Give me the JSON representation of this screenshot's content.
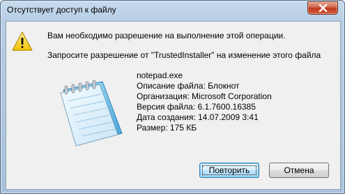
{
  "window": {
    "title": "Отсутствует доступ к файлу",
    "close_glyph": "close-icon"
  },
  "message": {
    "line1": "Вам необходимо разрешение на выполнение этой операции.",
    "line2": "Запросите разрешение от \"TrustedInstaller\" на изменение этого файла"
  },
  "file": {
    "name": "notepad.exe",
    "description": "Описание файла: Блокнот",
    "organization": "Организация: Microsoft Corporation",
    "version": "Версия файла: 6.1.7600.16385",
    "created": "Дата создания: 14.07.2009 3:41",
    "size": "Размер: 175 КБ"
  },
  "buttons": {
    "retry": "Повторить",
    "cancel": "Отмена"
  },
  "icons": {
    "warning": "warning-icon",
    "file": "notepad-icon"
  }
}
